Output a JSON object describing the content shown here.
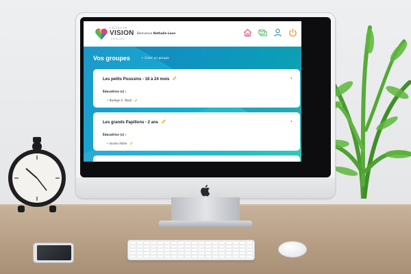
{
  "header": {
    "logo_top": "L'ÉCOLE EN",
    "logo_name": "VISION",
    "logo_sub": "CRÈCHE",
    "welcome_prefix": "Bienvenue",
    "welcome_name": "Nathalie Leon",
    "icons": [
      "home-icon",
      "messages-icon",
      "user-icon",
      "power-icon"
    ]
  },
  "main": {
    "title": "Vos groupes",
    "create_link": "+ Créer un groupe",
    "groups": [
      {
        "name": "Les petits Poussins - 18 à 24 mois",
        "role": "Éducatrice (s) :",
        "members": [
          "• Nadège A. (Nad)"
        ]
      },
      {
        "name": "Les grands Papillons - 2 ans",
        "role": "Éducatrice (s) :",
        "members": [
          "• Vanille Adèle"
        ]
      }
    ]
  },
  "colors": {
    "screen_bg": "#16a9d2",
    "accent_pink": "#e0417a",
    "accent_green": "#4cbb54",
    "accent_blue": "#2f83c8",
    "accent_orange": "#f28b22",
    "pencil_yellow": "#f2b71a"
  }
}
